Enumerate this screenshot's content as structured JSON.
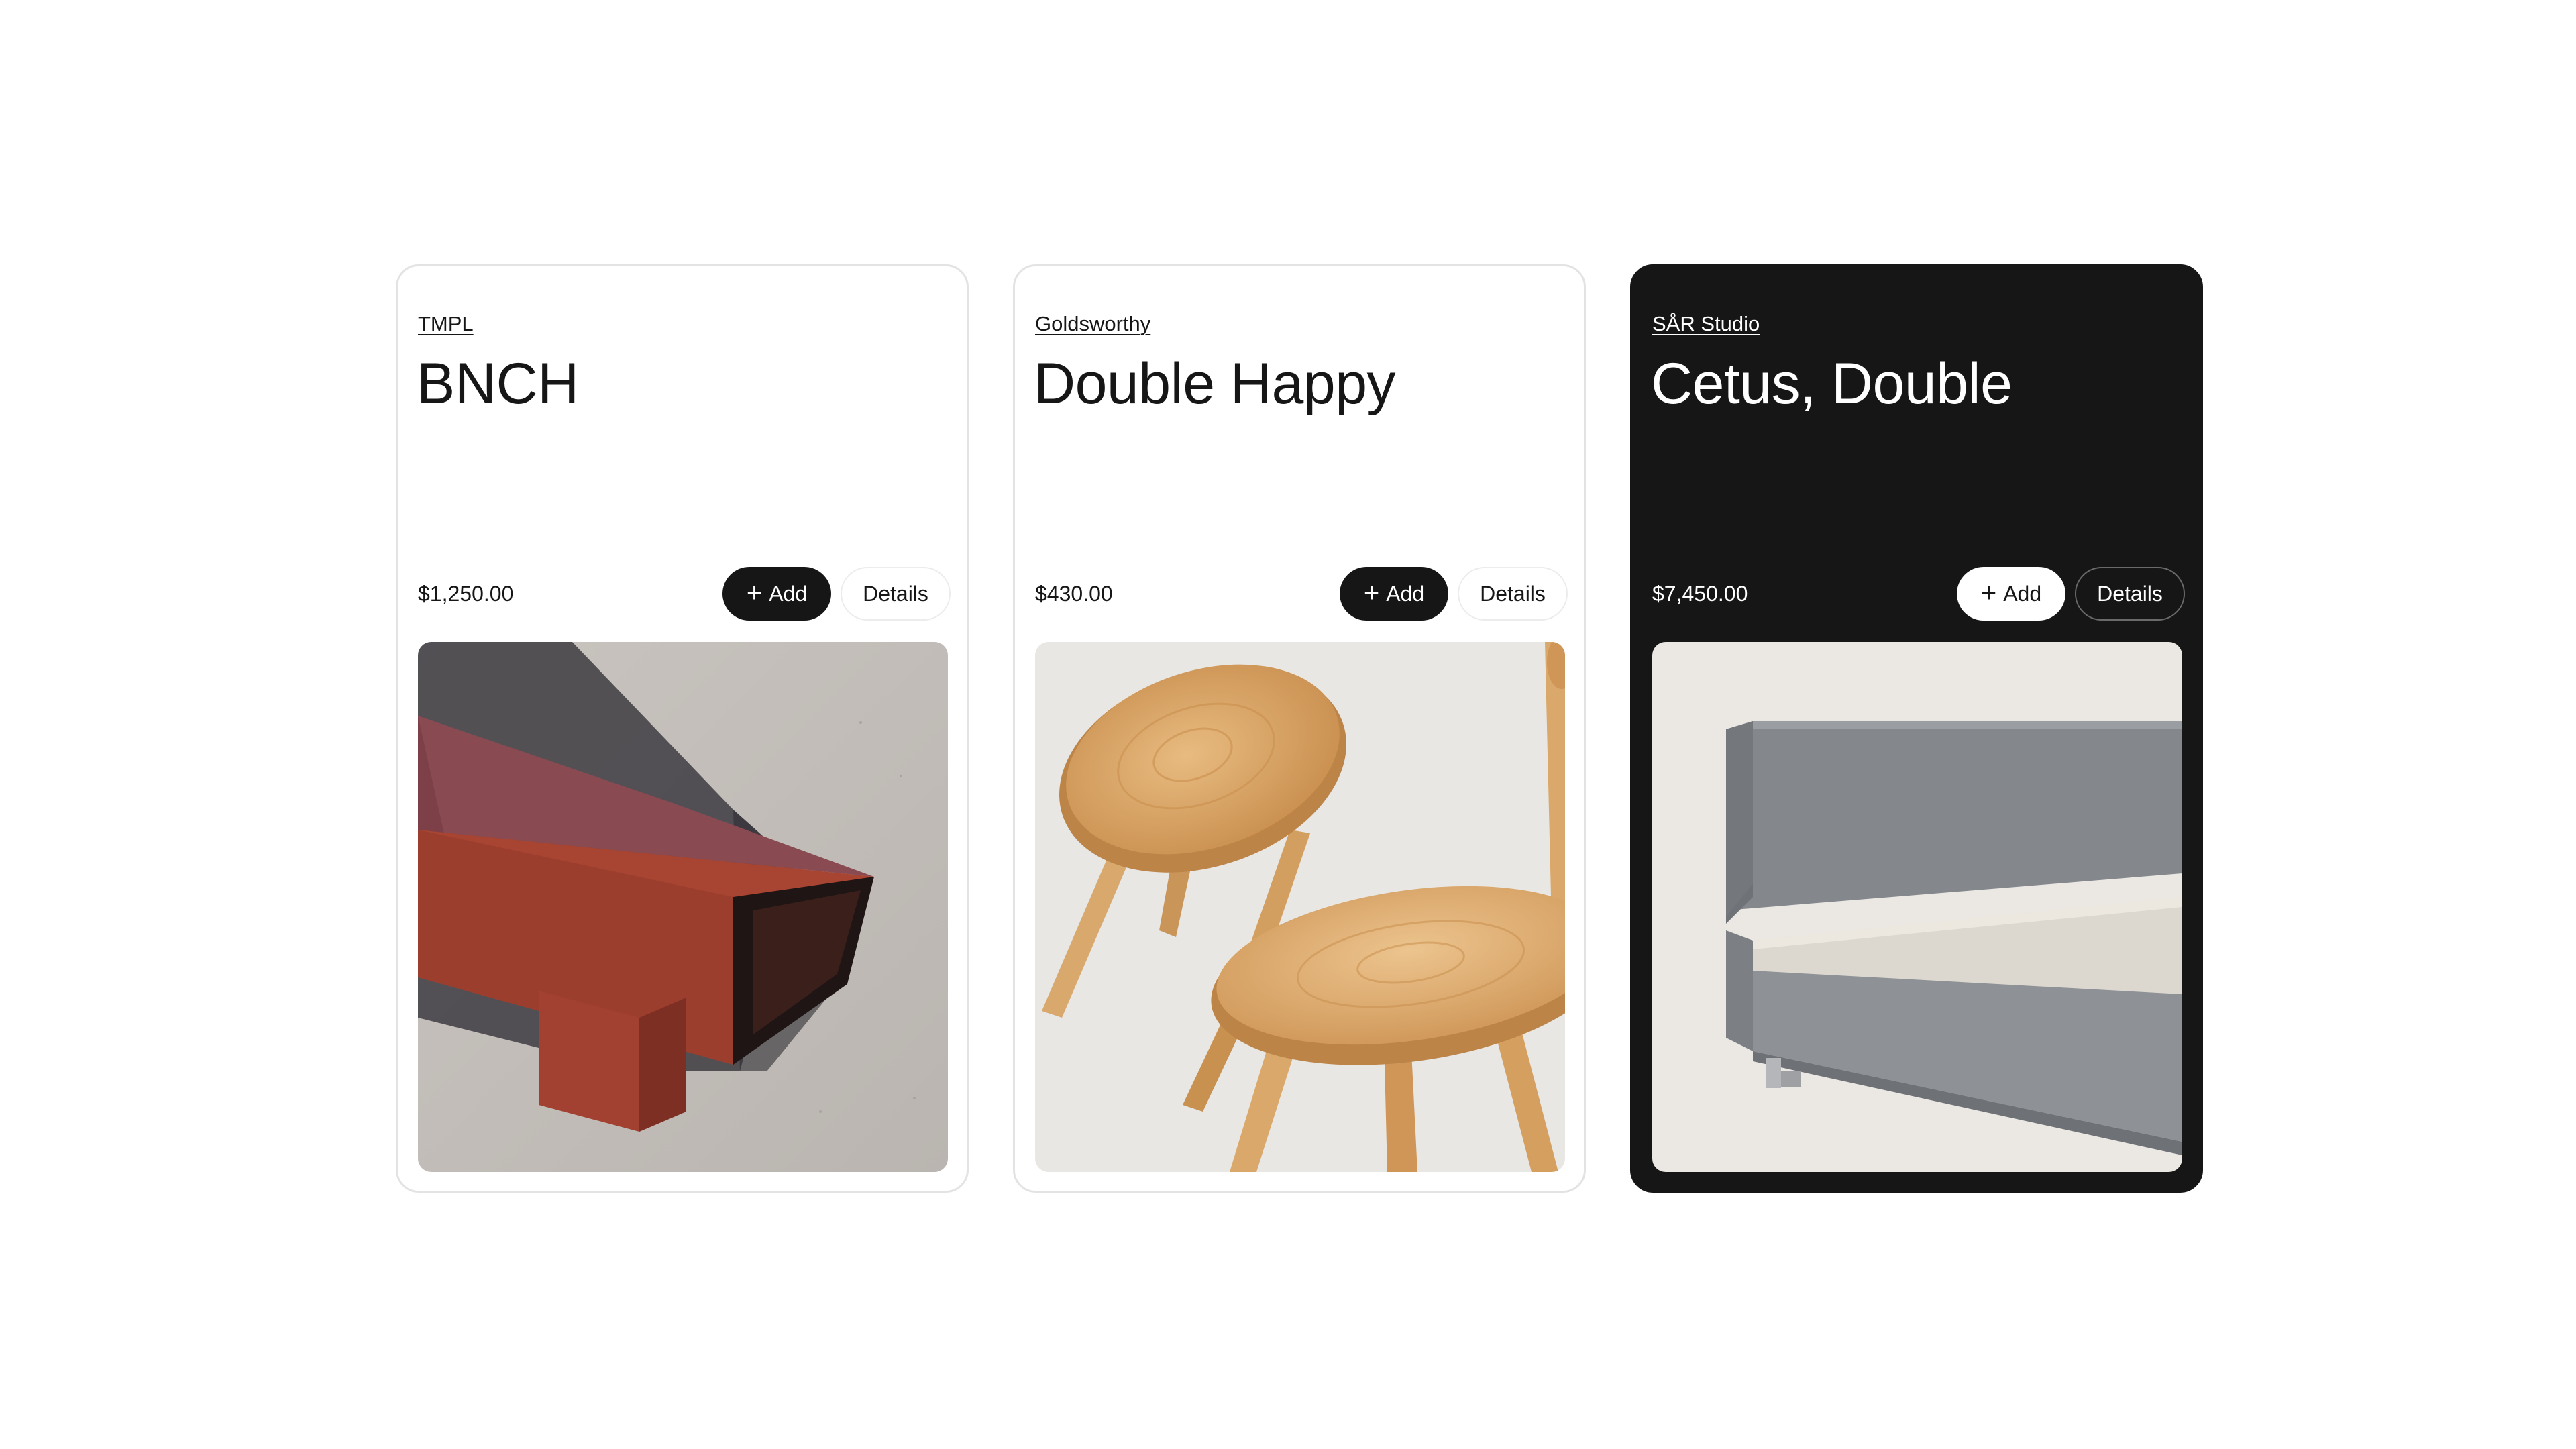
{
  "products": [
    {
      "brand": "TMPL",
      "name": "BNCH",
      "price": "$1,250.00",
      "add_label": "Add",
      "details_label": "Details",
      "image_icon": "red-steel-bench-photo"
    },
    {
      "brand": "Goldsworthy",
      "name": "Double Happy",
      "price": "$430.00",
      "add_label": "Add",
      "details_label": "Details",
      "image_icon": "wooden-stools-photo"
    },
    {
      "brand": "SÅR Studio",
      "name": "Cetus, Double",
      "price": "$7,450.00",
      "add_label": "Add",
      "details_label": "Details",
      "image_icon": "grey-upholstered-bed-photo"
    }
  ],
  "colors": {
    "ink": "#161616",
    "card_border": "#e3e3e3",
    "dark_card": "#161616",
    "bench_red": "#a84432",
    "wood": "#d9a86a",
    "bed_grey": "#8e9196"
  }
}
